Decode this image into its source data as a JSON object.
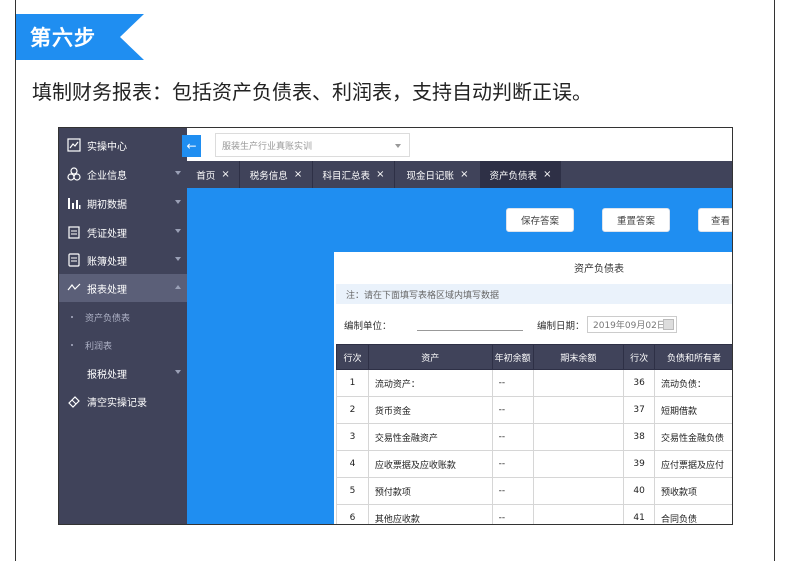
{
  "header": {
    "step_label": "第六步",
    "description": "填制财务报表：包括资产负债表、利润表，支持自动判断正误。"
  },
  "colors": {
    "brand_blue": "#1f8ef1",
    "sidebar": "#40435a"
  },
  "sidebar": {
    "items": [
      {
        "label": "实操中心",
        "icon": "chart-board-icon"
      },
      {
        "label": "企业信息",
        "icon": "group-icon"
      },
      {
        "label": "期初数据",
        "icon": "bar-chart-icon"
      },
      {
        "label": "凭证处理",
        "icon": "clipboard-icon"
      },
      {
        "label": "账簿处理",
        "icon": "notebook-icon"
      },
      {
        "label": "报表处理",
        "icon": "trend-line-icon"
      },
      {
        "label": "报税处理",
        "icon": ""
      },
      {
        "label": "清空实操记录",
        "icon": "eraser-icon"
      }
    ],
    "sub_items": [
      {
        "label": "资产负债表"
      },
      {
        "label": "利润表"
      }
    ]
  },
  "topbar": {
    "company_placeholder": "服装生产行业真账实训",
    "collapse_icon": "arrow-left-icon"
  },
  "tabs": [
    {
      "label": "首页",
      "close": "×"
    },
    {
      "label": "税务信息",
      "close": "×"
    },
    {
      "label": "科目汇总表",
      "close": "×"
    },
    {
      "label": "现金日记账",
      "close": "×"
    },
    {
      "label": "资产负债表",
      "close": "×"
    }
  ],
  "actions": {
    "save": "保存答案",
    "reset": "重置答案",
    "view": "查看"
  },
  "report": {
    "title": "资产负债表",
    "note": "注：请在下面填写表格区域内填写数据",
    "unit_label": "编制单位：",
    "date_label": "编制日期：",
    "date_value": "2019年09月02日",
    "columns": [
      "行次",
      "资产",
      "年初余额",
      "期末余额",
      "行次",
      "负债和所有者"
    ],
    "rows": [
      [
        "1",
        "流动资产：",
        "--",
        "",
        "36",
        "流动负债："
      ],
      [
        "2",
        "货币资金",
        "--",
        "",
        "37",
        "短期借款"
      ],
      [
        "3",
        "交易性金融资产",
        "--",
        "",
        "38",
        "交易性金融负债"
      ],
      [
        "4",
        "应收票据及应收账款",
        "--",
        "",
        "39",
        "应付票据及应付"
      ],
      [
        "5",
        "预付款项",
        "--",
        "",
        "40",
        "预收款项"
      ],
      [
        "6",
        "其他应收款",
        "--",
        "",
        "41",
        "合同负债"
      ]
    ]
  }
}
